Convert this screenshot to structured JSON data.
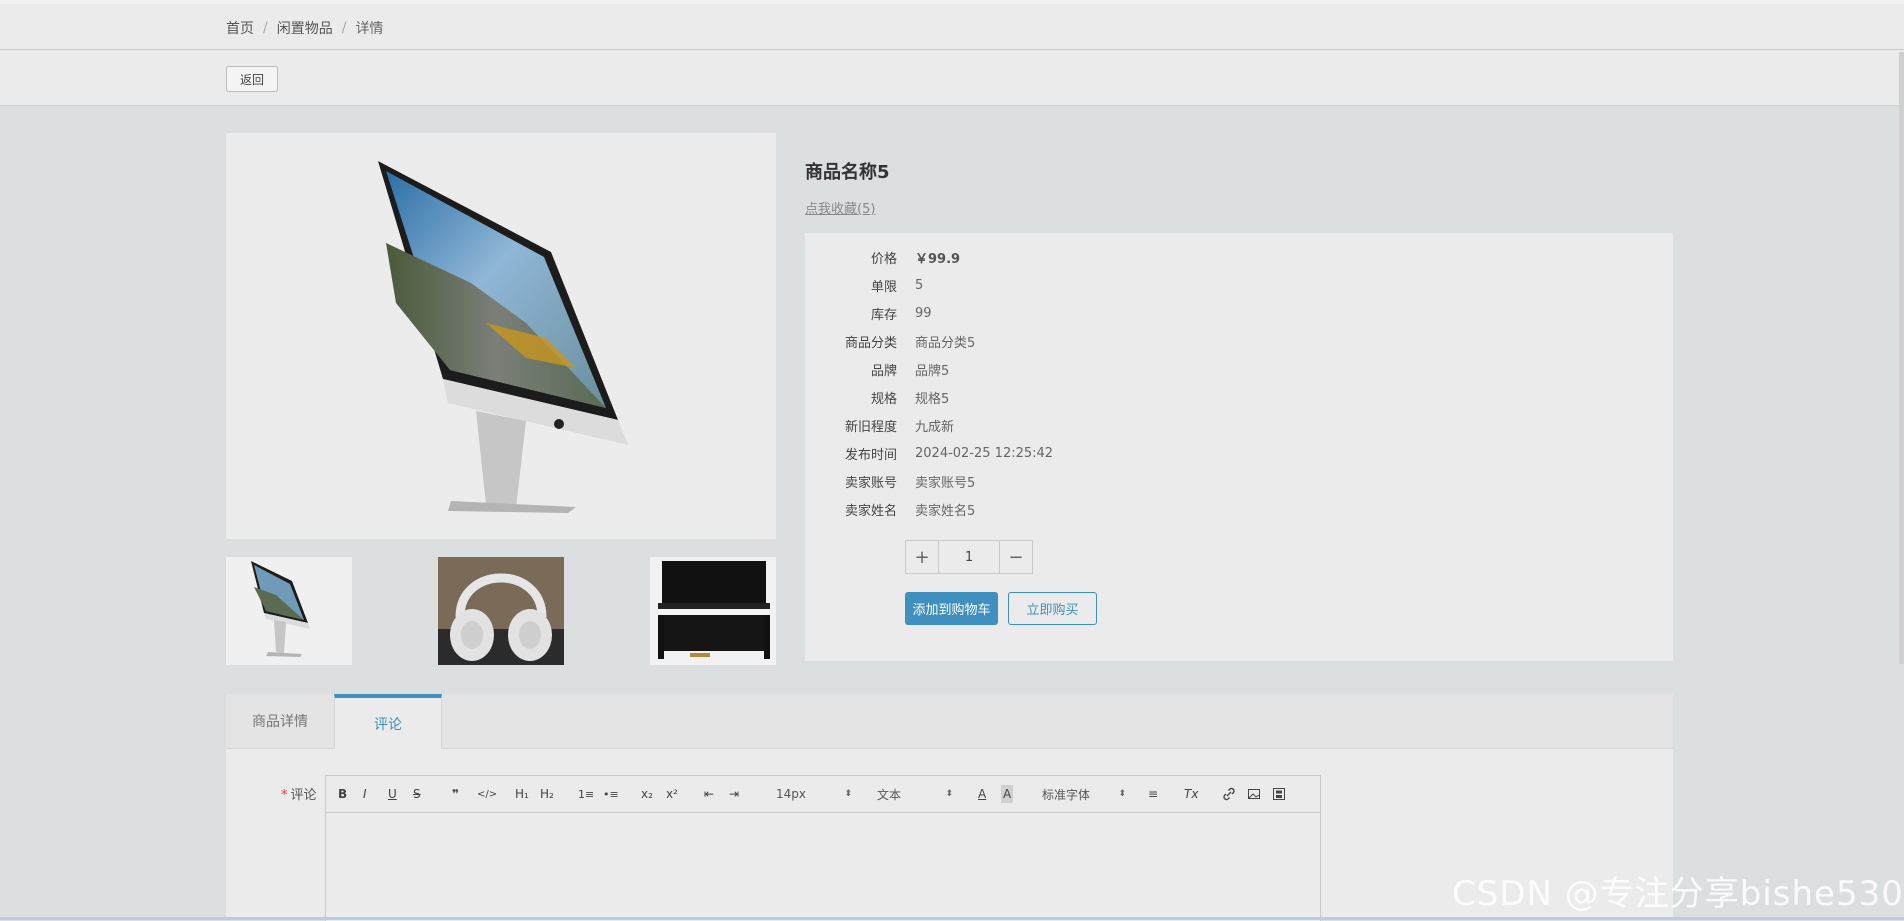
{
  "breadcrumb": {
    "home": "首页",
    "category": "闲置物品",
    "current": "详情",
    "separator": "/"
  },
  "toolbar": {
    "back_label": "返回"
  },
  "product": {
    "title": "商品名称5",
    "likes_label": "点我收藏(5)",
    "specs": [
      {
        "label": "价格",
        "value": "￥99.9"
      },
      {
        "label": "单限",
        "value": "5"
      },
      {
        "label": "库存",
        "value": "99"
      },
      {
        "label": "商品分类",
        "value": "商品分类5"
      },
      {
        "label": "品牌",
        "value": "品牌5"
      },
      {
        "label": "规格",
        "value": "规格5"
      },
      {
        "label": "新旧程度",
        "value": "九成新"
      },
      {
        "label": "发布时间",
        "value": "2024-02-25 12:25:42"
      },
      {
        "label": "卖家账号",
        "value": "卖家账号5"
      },
      {
        "label": "卖家姓名",
        "value": "卖家姓名5"
      }
    ],
    "quantity": "1",
    "plus_label": "+",
    "minus_label": "−",
    "add_to_cart_label": "添加到购物车",
    "buy_now_label": "立即购买"
  },
  "images": {
    "main": "imac-image",
    "thumbnails": [
      "imac-image",
      "headphones-image",
      "piano-image"
    ]
  },
  "tabs": [
    {
      "label": "商品详情"
    },
    {
      "label": "评论"
    }
  ],
  "comment": {
    "required_mark": "*",
    "label": "评论",
    "toolbar": {
      "bold": "B",
      "italic": "I",
      "underline": "U",
      "strike": "S",
      "quote": "❞",
      "code": "</>",
      "h1": "H₁",
      "h2": "H₂",
      "ordered_list": "1≡",
      "bullet_list": "•≡",
      "subscript": "x₂",
      "superscript": "x²",
      "indent_decrease": "⇤",
      "indent_increase": "⇥",
      "font_size": "14px",
      "text_type": "文本",
      "font_color": "A",
      "background_color": "A",
      "font_family": "标准字体",
      "align": "≡",
      "clear_format": "Tx"
    }
  },
  "watermark": "CSDN @专注分享bishe530",
  "colors": {
    "accent": "#3f8fbf",
    "background": "#dcdfe0",
    "panel": "#ebebeb"
  }
}
